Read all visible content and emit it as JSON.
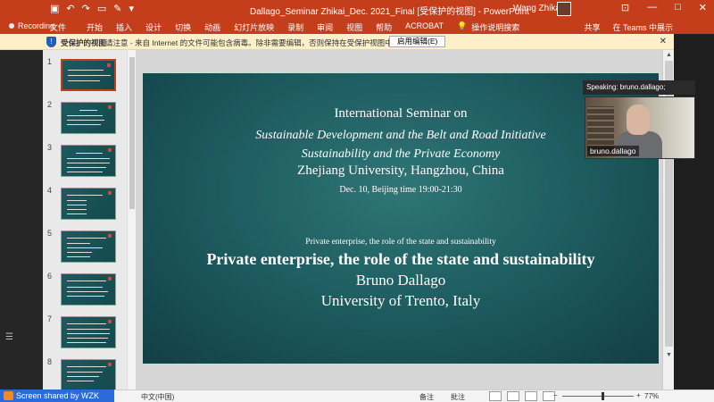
{
  "titlebar": {
    "title": "Dallago_Seminar Zhikai_Dec. 2021_Final [受保护的视图] - PowerPoint",
    "user": "Wang Zhikai"
  },
  "ribbon": {
    "recording": "Recording",
    "tabs": [
      "文件",
      "开始",
      "插入",
      "设计",
      "切换",
      "动画",
      "幻灯片放映",
      "录制",
      "审阅",
      "视图",
      "帮助",
      "ACROBAT",
      "操作说明搜索"
    ],
    "share": "共享",
    "teams": "在 Teams 中展示"
  },
  "protected_view": {
    "label": "受保护的视图",
    "message": "请注意 - 来自 Internet 的文件可能包含病毒。除非需要编辑，否则保持在受保护视图中比较安全。",
    "enable_button": "启用编辑(E)"
  },
  "thumbnails": [
    {
      "num": "1"
    },
    {
      "num": "2"
    },
    {
      "num": "3"
    },
    {
      "num": "4"
    },
    {
      "num": "5"
    },
    {
      "num": "6"
    },
    {
      "num": "7"
    },
    {
      "num": "8"
    }
  ],
  "slide": {
    "line1": "International Seminar on",
    "line2": "Sustainable Development and the Belt and Road Initiative",
    "line3": "Sustainability and the Private Economy",
    "line4": "Zhejiang University, Hangzhou, China",
    "line5": "Dec. 10, Beijing time 19:00-21:30",
    "line6": "Private enterprise, the role of the state and sustainability",
    "line7": "Private enterprise, the role of the state and sustainability",
    "line8": "Bruno Dallago",
    "line9": "University of Trento, Italy"
  },
  "video": {
    "speaking": "Speaking: bruno.dallago;",
    "name": "bruno.dallago"
  },
  "status": {
    "language": "中文(中国)",
    "notes": "备注",
    "comments": "批注",
    "zoom": "77%"
  },
  "zoom_share": {
    "label": "Screen shared by WZK"
  }
}
